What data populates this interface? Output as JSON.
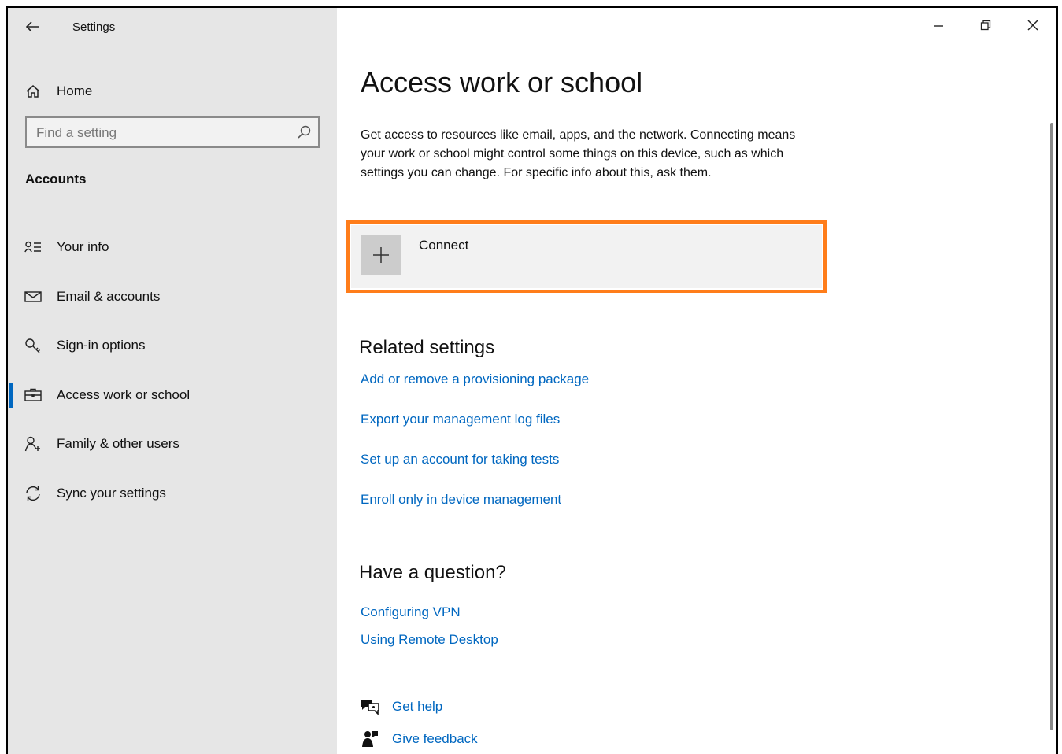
{
  "window": {
    "title": "Settings"
  },
  "sidebar": {
    "home_label": "Home",
    "search_placeholder": "Find a setting",
    "section_title": "Accounts",
    "items": [
      {
        "label": "Your info",
        "icon": "person-card-icon"
      },
      {
        "label": "Email & accounts",
        "icon": "mail-icon"
      },
      {
        "label": "Sign-in options",
        "icon": "key-icon"
      },
      {
        "label": "Access work or school",
        "icon": "briefcase-icon",
        "selected": true
      },
      {
        "label": "Family & other users",
        "icon": "person-add-icon"
      },
      {
        "label": "Sync your settings",
        "icon": "sync-icon"
      }
    ]
  },
  "main": {
    "title": "Access work or school",
    "description": "Get access to resources like email, apps, and the network. Connecting means your work or school might control some things on this device, such as which settings you can change. For specific info about this, ask them.",
    "connect_label": "Connect",
    "related": {
      "heading": "Related settings",
      "links": [
        "Add or remove a provisioning package",
        "Export your management log files",
        "Set up an account for taking tests",
        "Enroll only in device management"
      ]
    },
    "question": {
      "heading": "Have a question?",
      "links": [
        "Configuring VPN",
        "Using Remote Desktop"
      ]
    },
    "help": {
      "get_help": "Get help",
      "give_feedback": "Give feedback"
    }
  },
  "colors": {
    "accent": "#0067c0",
    "highlight": "#ff7d1a",
    "sidebar_bg": "#e6e6e6"
  }
}
